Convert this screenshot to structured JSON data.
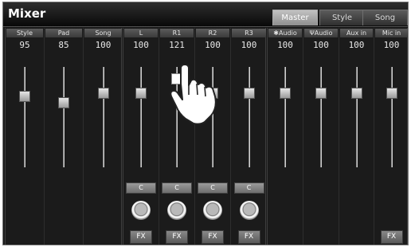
{
  "title": "Mixer",
  "tabs": [
    {
      "label": "Master",
      "active": true
    },
    {
      "label": "Style",
      "active": false
    },
    {
      "label": "Song",
      "active": false
    }
  ],
  "groups": [
    {
      "name": "style-group",
      "channels": [
        {
          "id": "style",
          "label": "Style",
          "value": "95",
          "level": 95,
          "c_label": "",
          "fx_label": ""
        },
        {
          "id": "pad",
          "label": "Pad",
          "value": "85",
          "level": 85,
          "c_label": "",
          "fx_label": ""
        },
        {
          "id": "song",
          "label": "Song",
          "value": "100",
          "level": 100,
          "c_label": "",
          "fx_label": ""
        }
      ]
    },
    {
      "name": "voice-group",
      "channels": [
        {
          "id": "l",
          "label": "L",
          "value": "100",
          "level": 100,
          "c_label": "C",
          "fx_label": "FX"
        },
        {
          "id": "r1",
          "label": "R1",
          "value": "121",
          "level": 121,
          "c_label": "C",
          "fx_label": "FX",
          "active": true
        },
        {
          "id": "r2",
          "label": "R2",
          "value": "100",
          "level": 100,
          "c_label": "C",
          "fx_label": "FX"
        },
        {
          "id": "r3",
          "label": "R3",
          "value": "100",
          "level": 100,
          "c_label": "C",
          "fx_label": "FX"
        }
      ]
    },
    {
      "name": "audio-group",
      "channels": [
        {
          "id": "bt-audio",
          "label": "✱Audio",
          "value": "100",
          "level": 100,
          "c_label": "",
          "fx_label": ""
        },
        {
          "id": "usb-audio",
          "label": "ΨAudio",
          "value": "100",
          "level": 100,
          "c_label": "",
          "fx_label": ""
        },
        {
          "id": "aux-in",
          "label": "Aux in",
          "value": "100",
          "level": 100,
          "c_label": "",
          "fx_label": ""
        },
        {
          "id": "mic-in",
          "label": "Mic in",
          "value": "100",
          "level": 100,
          "c_label": "",
          "fx_label": "FX"
        }
      ]
    }
  ],
  "icons": {
    "pointer": "hand-pointer-icon"
  }
}
